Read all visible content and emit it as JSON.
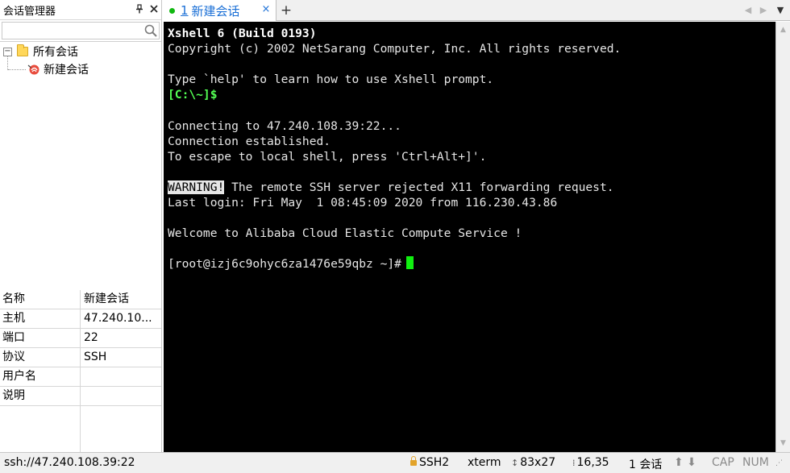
{
  "left_panel": {
    "title": "会话管理器",
    "pin_icon": "pin-icon",
    "close_icon": "close-icon",
    "search": {
      "placeholder": "",
      "value": ""
    },
    "tree": {
      "root_label": "所有会话",
      "child_label": "新建会话"
    },
    "properties": [
      {
        "key": "名称",
        "value": "新建会话"
      },
      {
        "key": "主机",
        "value": "47.240.10..."
      },
      {
        "key": "端口",
        "value": "22"
      },
      {
        "key": "协议",
        "value": "SSH"
      },
      {
        "key": "用户名",
        "value": ""
      },
      {
        "key": "说明",
        "value": ""
      }
    ]
  },
  "tabs": {
    "active": {
      "number": "1",
      "label": "新建会话"
    },
    "add_label": "+",
    "close_label": "×"
  },
  "terminal": {
    "lines": [
      "Xshell 6 (Build 0193)",
      "Copyright (c) 2002 NetSarang Computer, Inc. All rights reserved.",
      "",
      "Type `help' to learn how to use Xshell prompt.",
      "[C:\\~]$",
      "",
      "Connecting to 47.240.108.39:22...",
      "Connection established.",
      "To escape to local shell, press 'Ctrl+Alt+]'.",
      "",
      "WARNING!",
      " The remote SSH server rejected X11 forwarding request.",
      "Last login: Fri May  1 08:45:09 2020 from 116.230.43.86",
      "",
      "Welcome to Alibaba Cloud Elastic Compute Service !",
      "",
      "[root@izj6c9ohyc6za1476e59qbz ~]#"
    ]
  },
  "statusbar": {
    "address": "ssh://47.240.108.39:22",
    "protocol": "SSH2",
    "term_type": "xterm",
    "size": "83x27",
    "cursor_pos": "16,35",
    "sessions": "1 会话",
    "cap": "CAP",
    "num": "NUM"
  },
  "colors": {
    "terminal_bg": "#000000",
    "terminal_fg": "#e6e6e6",
    "prompt_green": "#54ff54",
    "cursor_green": "#10ef10",
    "tab_accent": "#1a6fd6",
    "status_dot": "#11b811"
  }
}
